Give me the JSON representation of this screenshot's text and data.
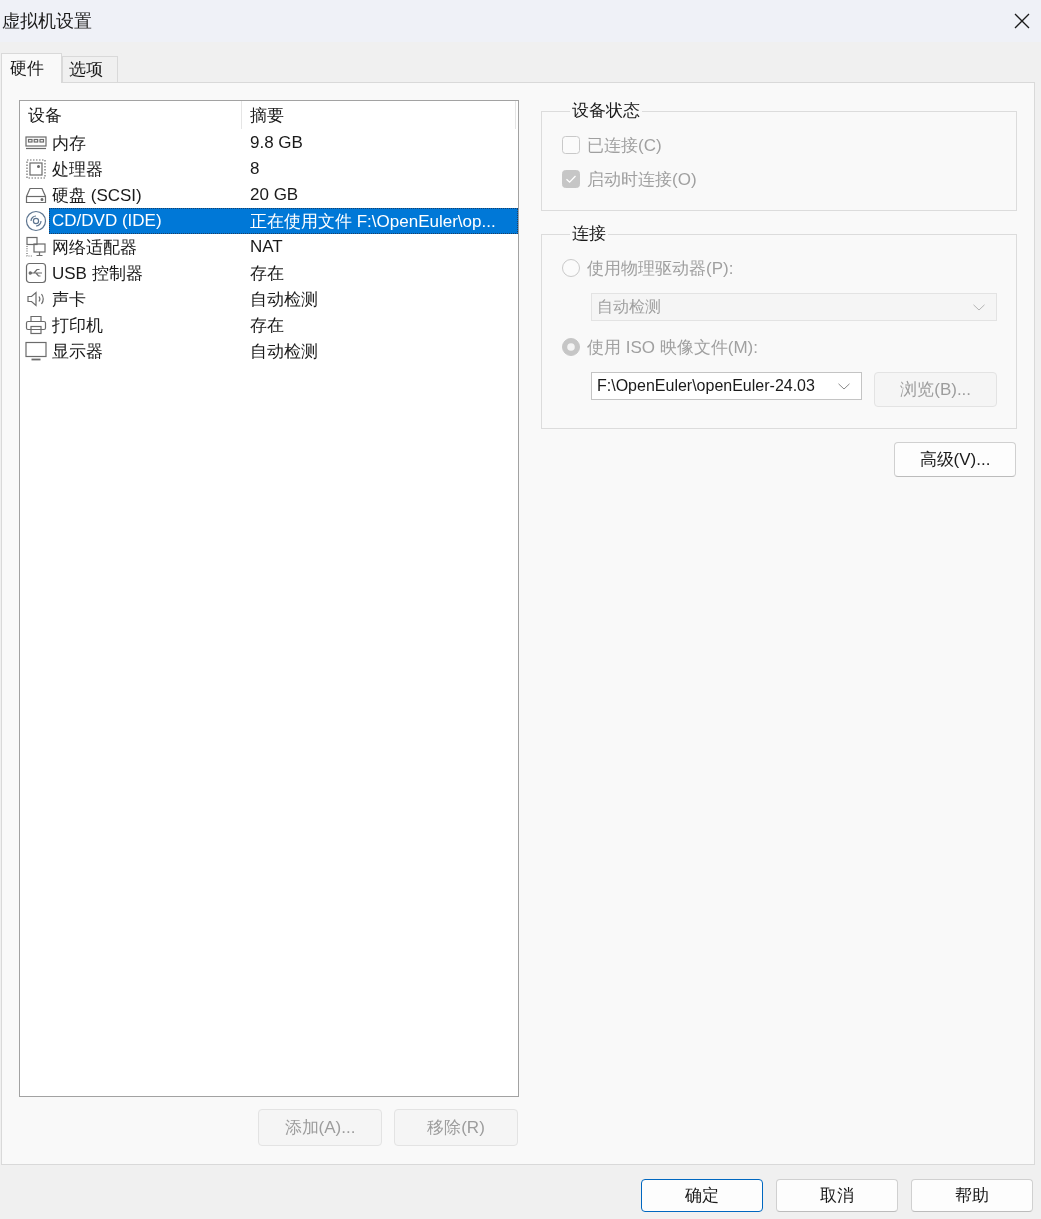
{
  "window": {
    "title": "虚拟机设置"
  },
  "tabs": [
    {
      "label": "硬件",
      "selected": true
    },
    {
      "label": "选项",
      "selected": false
    }
  ],
  "device_list": {
    "columns": [
      "设备",
      "摘要"
    ],
    "rows": [
      {
        "kind": "memory",
        "device": "内存",
        "summary": "9.8 GB",
        "selected": false
      },
      {
        "kind": "processor",
        "device": "处理器",
        "summary": "8",
        "selected": false
      },
      {
        "kind": "disk",
        "device": "硬盘 (SCSI)",
        "summary": "20 GB",
        "selected": false
      },
      {
        "kind": "cd",
        "device": "CD/DVD (IDE)",
        "summary": "正在使用文件 F:\\OpenEuler\\op...",
        "selected": true
      },
      {
        "kind": "network",
        "device": "网络适配器",
        "summary": "NAT",
        "selected": false
      },
      {
        "kind": "usb",
        "device": "USB 控制器",
        "summary": "存在",
        "selected": false
      },
      {
        "kind": "sound",
        "device": "声卡",
        "summary": "自动检测",
        "selected": false
      },
      {
        "kind": "printer",
        "device": "打印机",
        "summary": "存在",
        "selected": false
      },
      {
        "kind": "display",
        "device": "显示器",
        "summary": "自动检测",
        "selected": false
      }
    ]
  },
  "list_buttons": [
    {
      "label": "添加(A)...",
      "disabled": true
    },
    {
      "label": "移除(R)",
      "disabled": true
    }
  ],
  "device_status": {
    "title": "设备状态",
    "checkboxes": [
      {
        "label": "已连接(C)",
        "checked": false,
        "disabled": true
      },
      {
        "label": "启动时连接(O)",
        "checked": true,
        "disabled": true
      }
    ]
  },
  "connection": {
    "title": "连接",
    "options": [
      {
        "label": "使用物理驱动器(P):",
        "selected": false,
        "disabled": true,
        "field": {
          "value": "自动检测",
          "disabled": true
        }
      },
      {
        "label": "使用 ISO 映像文件(M):",
        "selected": true,
        "disabled": true,
        "field": {
          "value": "F:\\OpenEuler\\openEuler-24.03",
          "disabled": false
        },
        "button": {
          "label": "浏览(B)...",
          "disabled": true
        }
      }
    ]
  },
  "advanced_button": {
    "label": "高级(V)...",
    "disabled": false
  },
  "dialog_buttons": [
    {
      "label": "确定",
      "default": true
    },
    {
      "label": "取消",
      "default": false
    },
    {
      "label": "帮助",
      "default": false
    }
  ]
}
